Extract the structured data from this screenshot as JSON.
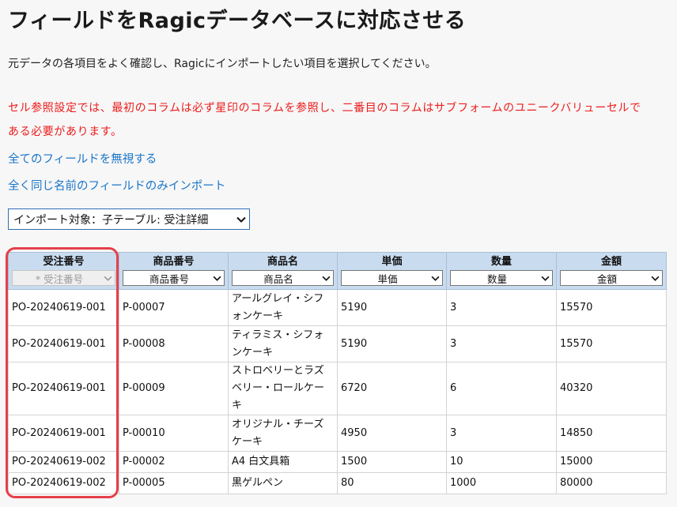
{
  "page": {
    "title": "フィールドをRagicデータベースに対応させる",
    "intro": "元データの各項目をよく確認し、Ragicにインポートしたい項目を選択してください。",
    "warning": "セル参照設定では、最初のコラムは必ず星印のコラムを参照し、二番目のコラムはサブフォームのユニークバリューセルである必要があります。",
    "ignore_all_link": "全てのフィールドを無視する",
    "import_same_name_link": "全く同じ名前のフィールドのみインポート",
    "import_target": "インポート対象：子テーブル: 受注詳細"
  },
  "colors": {
    "warning": "#ee1b1b",
    "link": "#1b76c9",
    "header_bg": "#c9dcef",
    "highlight": "#e5404a"
  },
  "table": {
    "columns": [
      {
        "label": "受注番号",
        "mapping": "* 受注番号",
        "disabled": true
      },
      {
        "label": "商品番号",
        "mapping": "商品番号",
        "disabled": false
      },
      {
        "label": "商品名",
        "mapping": "商品名",
        "disabled": false
      },
      {
        "label": "単価",
        "mapping": "単価",
        "disabled": false
      },
      {
        "label": "数量",
        "mapping": "数量",
        "disabled": false
      },
      {
        "label": "金額",
        "mapping": "金額",
        "disabled": false
      }
    ],
    "rows": [
      [
        "PO-20240619-001",
        "P-00007",
        "アールグレイ・シフォンケーキ",
        "5190",
        "3",
        "15570"
      ],
      [
        "PO-20240619-001",
        "P-00008",
        "ティラミス・シフォンケーキ",
        "5190",
        "3",
        "15570"
      ],
      [
        "PO-20240619-001",
        "P-00009",
        "ストロベリーとラズベリー・ロールケーキ",
        "6720",
        "6",
        "40320"
      ],
      [
        "PO-20240619-001",
        "P-00010",
        "オリジナル・チーズケーキ",
        "4950",
        "3",
        "14850"
      ],
      [
        "PO-20240619-002",
        "P-00002",
        "A4 白文具箱",
        "1500",
        "10",
        "15000"
      ],
      [
        "PO-20240619-002",
        "P-00005",
        "黒ゲルペン",
        "80",
        "1000",
        "80000"
      ]
    ]
  }
}
